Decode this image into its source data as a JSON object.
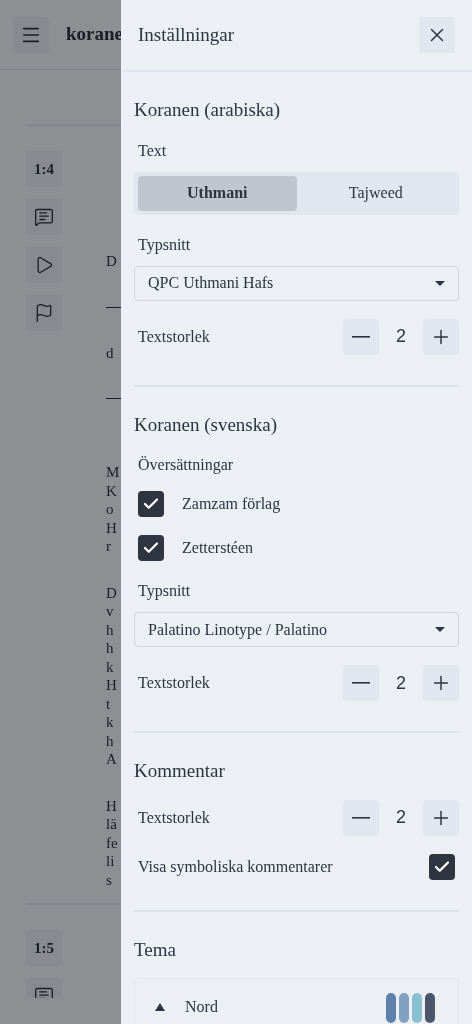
{
  "header": {
    "title": "korane"
  },
  "verses": [
    {
      "label": "1:4",
      "actions": [
        {
          "kind": "comment"
        },
        {
          "kind": "play"
        },
        {
          "kind": "flag"
        }
      ],
      "blocks": [
        {
          "kind": "line",
          "lines": [
            "D"
          ]
        },
        {
          "kind": "rule"
        },
        {
          "kind": "line",
          "lines": [
            "d"
          ]
        },
        {
          "kind": "rule"
        },
        {
          "kind": "para",
          "lines": [
            "M",
            "K",
            "o",
            "H",
            "r"
          ]
        },
        {
          "kind": "para",
          "lines": [
            "D",
            "v",
            "h",
            "h",
            "k",
            "H",
            "t",
            "k",
            "h",
            "A"
          ]
        },
        {
          "kind": "para",
          "lines": [
            "H",
            "lä",
            "fe",
            "li",
            "s"
          ]
        }
      ]
    },
    {
      "label": "1:5",
      "actions": [
        {
          "kind": "comment"
        }
      ]
    }
  ],
  "settings": {
    "title": "Inställningar",
    "sections": [
      {
        "title": "Koranen (arabiska)",
        "rows": [
          {
            "kind": "segmented",
            "label": "Text",
            "options": [
              {
                "label": "Uthmani",
                "selected": true
              },
              {
                "label": "Tajweed",
                "selected": false
              }
            ]
          },
          {
            "kind": "select",
            "label": "Typsnitt",
            "value": "QPC Uthmani Hafs"
          },
          {
            "kind": "stepper",
            "label": "Textstorlek",
            "value": "2"
          }
        ]
      },
      {
        "title": "Koranen (svenska)",
        "rows": [
          {
            "kind": "checklist",
            "label": "Översättningar",
            "items": [
              {
                "label": "Zamzam förlag",
                "checked": true
              },
              {
                "label": "Zetterstéen",
                "checked": true
              }
            ]
          },
          {
            "kind": "select",
            "label": "Typsnitt",
            "value": "Palatino Linotype / Palatino"
          },
          {
            "kind": "stepper",
            "label": "Textstorlek",
            "value": "2"
          }
        ]
      },
      {
        "title": "Kommentar",
        "rows": [
          {
            "kind": "stepper",
            "label": "Textstorlek",
            "value": "2"
          },
          {
            "kind": "toggle",
            "label": "Visa symboliska kommentarer",
            "checked": true
          }
        ]
      },
      {
        "title": "Tema",
        "rows": [
          {
            "kind": "themes",
            "themes": [
              {
                "name": "Nord",
                "swatches": [
                  {
                    "color": "#5e81ac"
                  },
                  {
                    "color": "#81a1c1"
                  },
                  {
                    "color": "#88c0d0"
                  },
                  {
                    "color": "#4c566a"
                  }
                ]
              }
            ]
          }
        ]
      }
    ]
  }
}
